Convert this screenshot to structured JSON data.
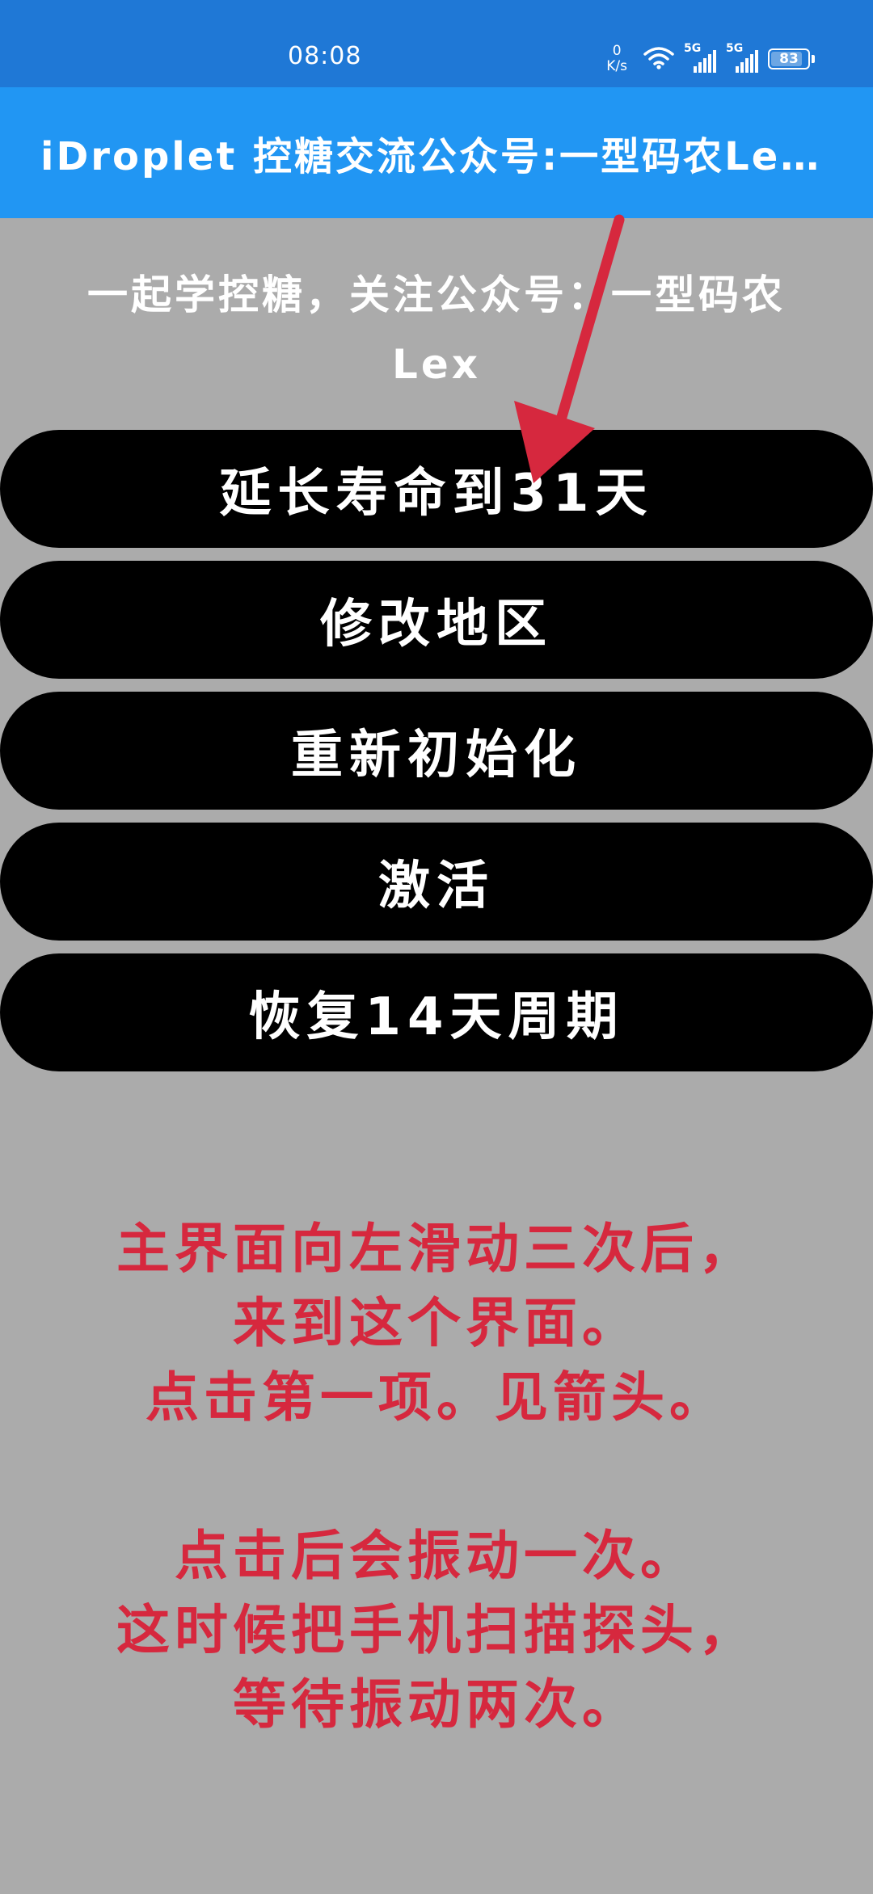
{
  "status_bar": {
    "time": "08:08",
    "net_speed_value": "0",
    "net_speed_unit": "K/s",
    "signal_1_label": "5G",
    "signal_2_label": "5G",
    "battery_percent": "83"
  },
  "app_bar": {
    "title": "iDroplet 控糖交流公众号:一型码农Le…"
  },
  "subtitle": {
    "line1": "一起学控糖，关注公众号：一型码农",
    "line2": "Lex"
  },
  "buttons": [
    {
      "label": "延长寿命到31天"
    },
    {
      "label": "修改地区"
    },
    {
      "label": "重新初始化"
    },
    {
      "label": "激活"
    },
    {
      "label": "恢复14天周期"
    }
  ],
  "instructions": {
    "lines_1": [
      "主界面向左滑动三次后，",
      "来到这个界面。",
      "点击第一项。见箭头。"
    ],
    "lines_2": [
      "点击后会振动一次。",
      "这时候把手机扫描探头，",
      "等待振动两次。"
    ]
  },
  "colors": {
    "status_bar": "#1f78d6",
    "app_bar": "#2196f3",
    "background": "#ababab",
    "button": "#000000",
    "annotation_red": "#d6283e"
  },
  "icons": [
    "wifi-icon",
    "signal-icon",
    "battery-icon",
    "arrow-annotation"
  ]
}
